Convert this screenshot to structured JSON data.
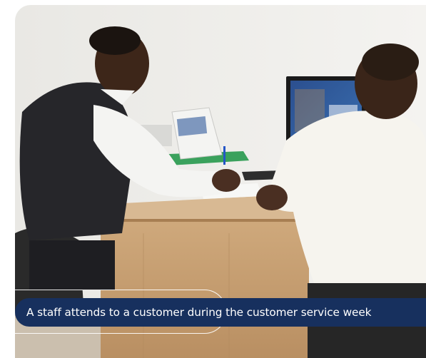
{
  "photo": {
    "alt": "A staff member seated at a desk talking with a customer"
  },
  "caption": {
    "text": "A staff attends to a customer during the customer service week"
  },
  "colors": {
    "caption_background": "#17305e",
    "caption_text": "#ffffff"
  }
}
